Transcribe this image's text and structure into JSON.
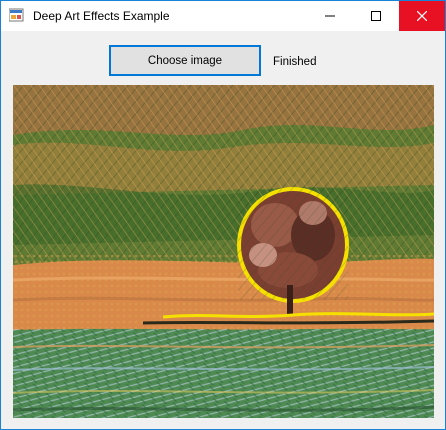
{
  "window": {
    "title": "Deep Art Effects Example",
    "icons": {
      "app": "app-window-icon",
      "minimize": "minimize-icon",
      "maximize": "maximize-icon",
      "close": "close-icon"
    },
    "colors": {
      "accent": "#0078d7",
      "close_hover": "#e81123",
      "client_background": "#f0f0f0"
    }
  },
  "toolbar": {
    "choose_label": "Choose image",
    "status_text": "Finished"
  },
  "image": {
    "description": "stylized-landscape-tree-field",
    "palette": {
      "sky": "#5f7a32",
      "field": "#d98a4a",
      "tree": "#6b3a2c",
      "crop": "#4e8a52",
      "highlight": "#f5e000"
    }
  }
}
